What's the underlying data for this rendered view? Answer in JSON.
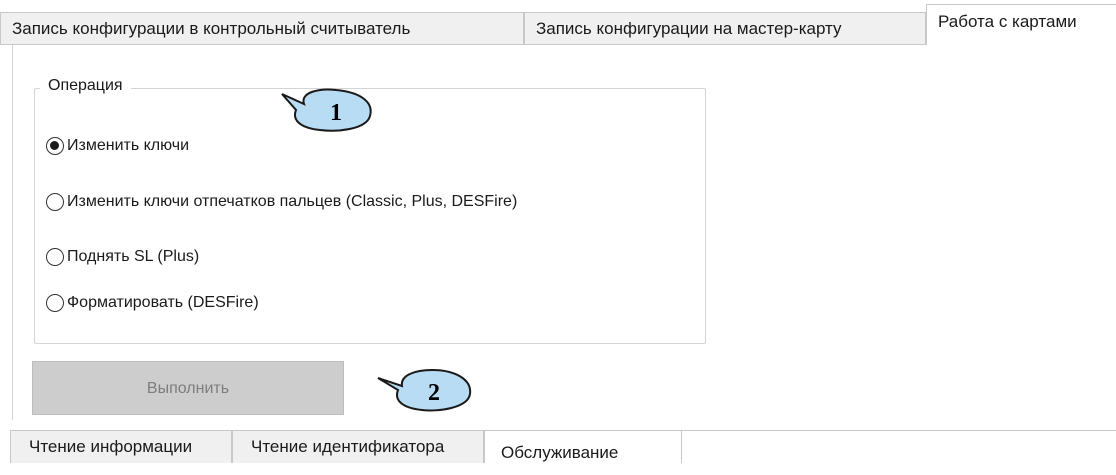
{
  "top_tabs": [
    {
      "label": "Запись конфигурации в контрольный считыватель"
    },
    {
      "label": "Запись конфигурации на мастер-карту"
    },
    {
      "label": "Работа с картами"
    }
  ],
  "operation": {
    "group_label": "Операция",
    "options": [
      {
        "label": "Изменить ключи",
        "checked": true
      },
      {
        "label": "Изменить ключи отпечатков пальцев (Classic, Plus, DESFire)",
        "checked": false
      },
      {
        "label": "Поднять SL (Plus)",
        "checked": false
      },
      {
        "label": "Форматировать  (DESFire)",
        "checked": false
      }
    ]
  },
  "execute_button": {
    "label": "Выполнить",
    "enabled": false
  },
  "callouts": [
    {
      "number": "1"
    },
    {
      "number": "2"
    }
  ],
  "bottom_tabs": [
    {
      "label": "Чтение информации"
    },
    {
      "label": "Чтение идентификатора"
    },
    {
      "label": "Обслуживание"
    }
  ],
  "colors": {
    "callout_fill": "#b8dcf4",
    "callout_stroke": "#1a1a1a",
    "button_disabled": "#cdcdcd"
  }
}
